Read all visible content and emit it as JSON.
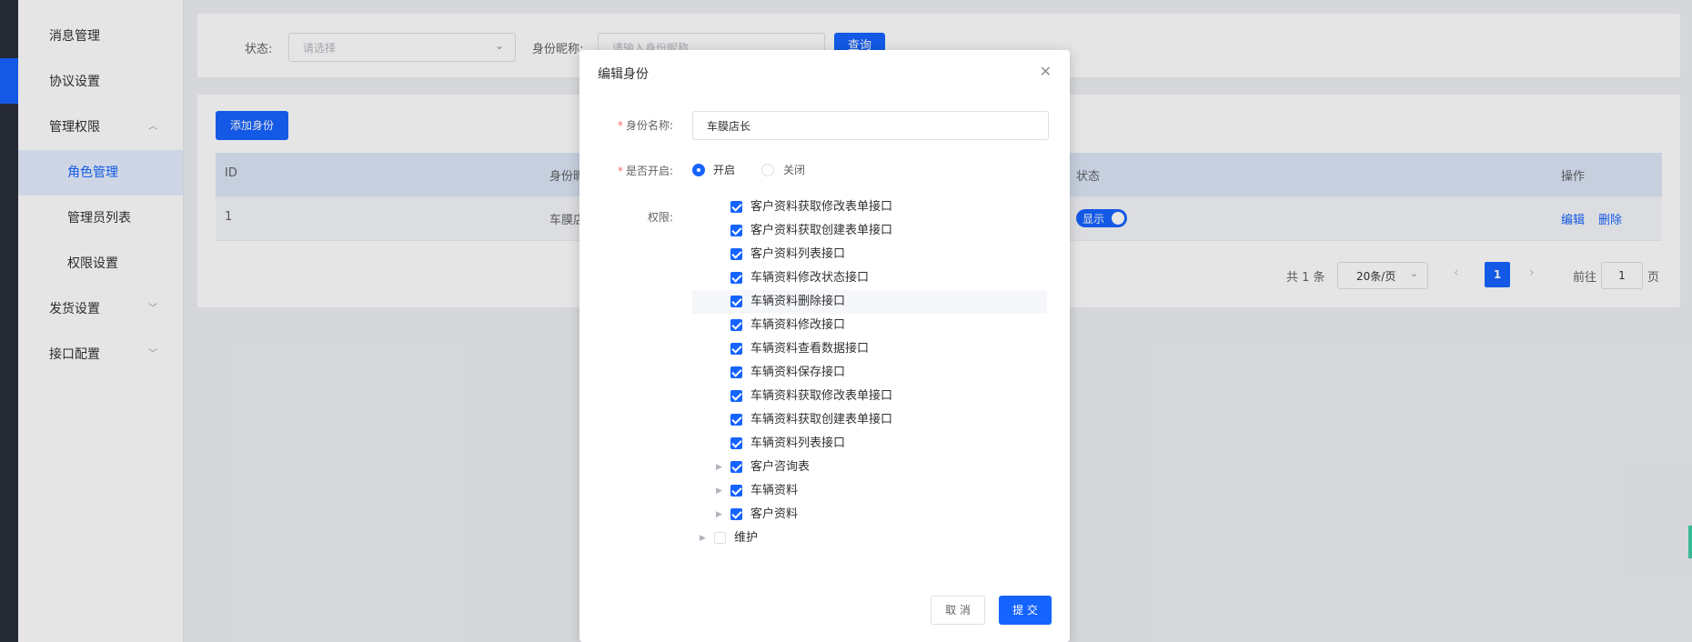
{
  "sidebar": {
    "items": [
      {
        "label": "消息管理"
      },
      {
        "label": "协议设置"
      },
      {
        "label": "管理权限",
        "expanded": true
      },
      {
        "label": "角色管理",
        "active": true
      },
      {
        "label": "管理员列表"
      },
      {
        "label": "权限设置"
      },
      {
        "label": "发货设置"
      },
      {
        "label": "接口配置"
      }
    ]
  },
  "filter": {
    "status_label": "状态:",
    "status_placeholder": "请选择",
    "name_label": "身份昵称:",
    "name_placeholder": "请输入身份昵称",
    "query_button": "查询"
  },
  "table": {
    "add_button": "添加身份",
    "columns": [
      "ID",
      "身份昵称",
      "状态",
      "操作"
    ],
    "rows": [
      {
        "id": "1",
        "name": "车膜店长",
        "status_switch": "显示",
        "actions": [
          "编辑",
          "删除"
        ]
      }
    ]
  },
  "pagination": {
    "total": "共 1 条",
    "page_size": "20条/页",
    "current_page": "1",
    "goto_label": "前往",
    "goto_value": "1",
    "page_suffix": "页"
  },
  "dialog": {
    "title": "编辑身份",
    "name_label": "身份名称:",
    "name_value": "车膜店长",
    "enabled_label": "是否开启:",
    "radio_on": "开启",
    "radio_off": "关闭",
    "perm_label": "权限:",
    "permissions": [
      {
        "label": "客户资料获取修改表单接口",
        "checked": true,
        "level": 2,
        "has_children": false
      },
      {
        "label": "客户资料获取创建表单接口",
        "checked": true,
        "level": 2,
        "has_children": false
      },
      {
        "label": "客户资料列表接口",
        "checked": true,
        "level": 2,
        "has_children": false
      },
      {
        "label": "车辆资料修改状态接口",
        "checked": true,
        "level": 2,
        "has_children": false
      },
      {
        "label": "车辆资料删除接口",
        "checked": true,
        "level": 2,
        "has_children": false,
        "highlight": true
      },
      {
        "label": "车辆资料修改接口",
        "checked": true,
        "level": 2,
        "has_children": false
      },
      {
        "label": "车辆资料查看数据接口",
        "checked": true,
        "level": 2,
        "has_children": false
      },
      {
        "label": "车辆资料保存接口",
        "checked": true,
        "level": 2,
        "has_children": false
      },
      {
        "label": "车辆资料获取修改表单接口",
        "checked": true,
        "level": 2,
        "has_children": false
      },
      {
        "label": "车辆资料获取创建表单接口",
        "checked": true,
        "level": 2,
        "has_children": false
      },
      {
        "label": "车辆资料列表接口",
        "checked": true,
        "level": 2,
        "has_children": false
      },
      {
        "label": "客户咨询表",
        "checked": true,
        "level": 1,
        "has_children": true
      },
      {
        "label": "车辆资料",
        "checked": true,
        "level": 1,
        "has_children": true
      },
      {
        "label": "客户资料",
        "checked": true,
        "level": 1,
        "has_children": true
      },
      {
        "label": "维护",
        "checked": false,
        "level": 0,
        "has_children": true
      }
    ],
    "cancel_button": "取 消",
    "submit_button": "提 交"
  },
  "colors": {
    "accent": "#1664ff",
    "sidebar_active_bg": "#e6efff",
    "table_header_bg": "#dde7f7",
    "dark_rail": "#2b2f3a"
  }
}
